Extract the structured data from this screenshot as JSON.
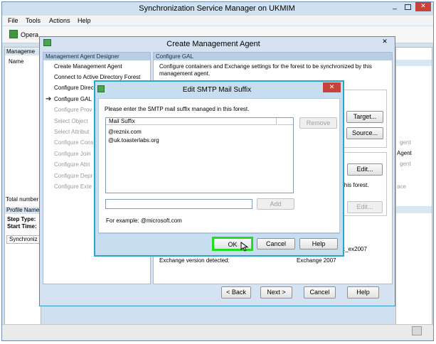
{
  "main_window": {
    "title": "Synchronization Service Manager on UKMIM",
    "menu": [
      "File",
      "Tools",
      "Actions",
      "Help"
    ],
    "toolbar_first_label": "Opera",
    "left_panel_header": "Manageme",
    "left_panel_column": "Name",
    "total_number_label": "Total number",
    "profile_name_label": "Profile Name",
    "step_type_label": "Step Type:",
    "start_time_label": "Start Time:",
    "sync_column_label": "Synchroniz"
  },
  "cma_dialog": {
    "title": "Create Management Agent",
    "designer_header": "Management Agent Designer",
    "nav_items": [
      {
        "label": "Create Management Agent",
        "state": "enabled"
      },
      {
        "label": "Connect to Active Directory Forest",
        "state": "enabled"
      },
      {
        "label": "Configure Direc",
        "state": "enabled"
      },
      {
        "label": "Configure GAL",
        "state": "current"
      },
      {
        "label": "Configure Prov",
        "state": "disabled"
      },
      {
        "label": "Select Object",
        "state": "disabled"
      },
      {
        "label": "Select Attribut",
        "state": "disabled"
      },
      {
        "label": "Configure Cons",
        "state": "disabled"
      },
      {
        "label": "Configure Join",
        "state": "disabled"
      },
      {
        "label": "Configure Attri",
        "state": "disabled"
      },
      {
        "label": "Configure Depr",
        "state": "disabled"
      },
      {
        "label": "Configure Exte",
        "state": "disabled"
      }
    ],
    "page_header": "Configure GAL",
    "page_description": "Configure containers and Exchange settings for the forest to be synchronized by this management agent.",
    "target_button": "Target...",
    "source_button": "Source...",
    "edit_button_1": "Edit...",
    "this_forest_text": "n this forest.",
    "edit_button_2": "Edit...",
    "ex2007_text": ":_ex2007",
    "exchange_version_label": "Exchange version detected:",
    "exchange_version_value": "Exchange 2007",
    "back_button": "< Back",
    "next_button": "Next >",
    "cancel_button": "Cancel",
    "help_button": "Help"
  },
  "background_fragments": {
    "agent_1": "gent",
    "agent_2": "Agent",
    "agent_3": "gent",
    "ace": "ace"
  },
  "smtp_dialog": {
    "title": "Edit SMTP Mail Suffix",
    "instruction": "Please enter the SMTP mail suffix managed in this forest.",
    "list_header": "Mail Suffix",
    "suffixes": [
      "@reznix.com",
      "@uk.toasterlabs.org"
    ],
    "remove_button": "Remove",
    "input_value": "",
    "add_button": "Add",
    "example_text": "For example: @microsoft.com",
    "ok_button": "OK",
    "cancel_button": "Cancel",
    "help_button": "Help"
  },
  "colors": {
    "dialog_border": "#28a8c9",
    "title_bar": "#d6e5f5",
    "close_red": "#c0392b",
    "ok_highlight": "#22dd22",
    "section_header": "#b9cde4"
  }
}
